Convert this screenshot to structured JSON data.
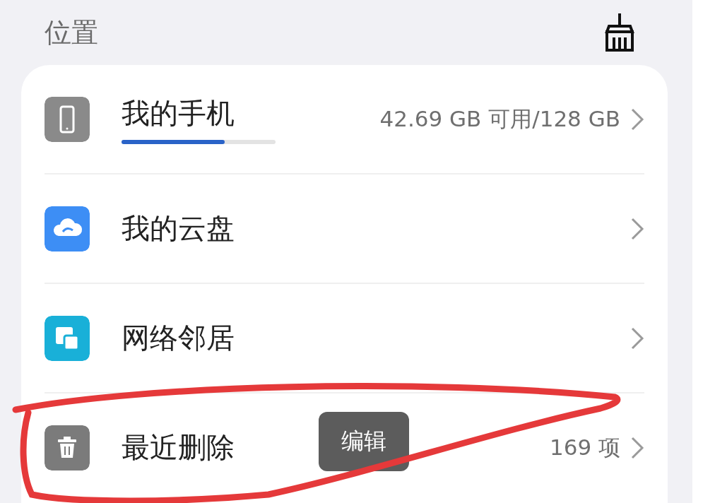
{
  "section": {
    "title": "位置"
  },
  "locations": [
    {
      "kind": "phone",
      "name": "我的手机",
      "detail": "42.69 GB 可用/128 GB",
      "level": 0.67
    },
    {
      "kind": "cloud",
      "name": "我的云盘"
    },
    {
      "kind": "network",
      "name": "网络邻居"
    },
    {
      "kind": "trash",
      "name": "最近删除",
      "detail": "169 项",
      "popup": "编辑"
    }
  ]
}
